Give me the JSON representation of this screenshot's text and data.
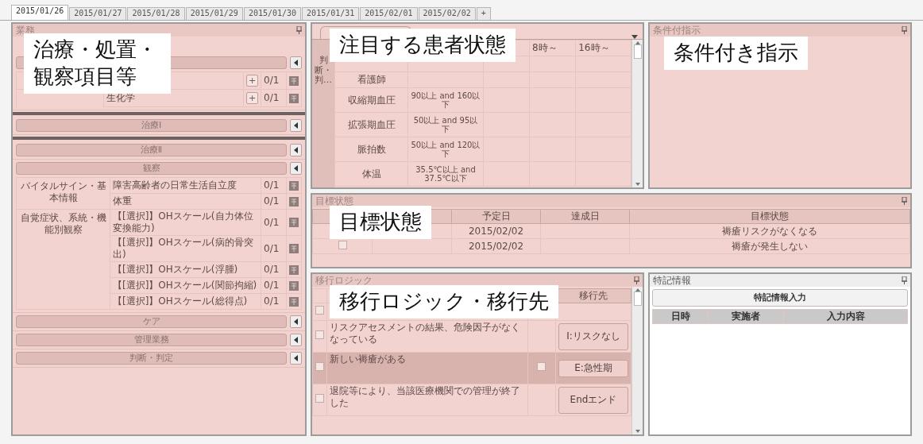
{
  "tabs": [
    {
      "label": "2015/01/26",
      "selected": true
    },
    {
      "label": "2015/01/27",
      "selected": false
    },
    {
      "label": "2015/01/28",
      "selected": false
    },
    {
      "label": "2015/01/29",
      "selected": false
    },
    {
      "label": "2015/01/30",
      "selected": false
    },
    {
      "label": "2015/01/31",
      "selected": false
    },
    {
      "label": "2015/02/01",
      "selected": false
    },
    {
      "label": "2015/02/02",
      "selected": false
    },
    {
      "label": "+",
      "selected": false
    }
  ],
  "left_panel": {
    "title": "業務",
    "callout": "治療・処置・観察項目等",
    "sections": [
      {
        "kind": "items",
        "divider_above": false,
        "items": [
          {
            "add": "+",
            "count": "0/1"
          },
          {
            "name": "生化学",
            "add": "+",
            "count": "0/1"
          }
        ]
      },
      {
        "kind": "bar",
        "label": "治療Ⅰ",
        "divider_above": true
      },
      {
        "kind": "bar",
        "label": "治療Ⅱ",
        "divider_above": true
      },
      {
        "kind": "groups",
        "label": "観察",
        "divider_above": false,
        "groups": [
          {
            "name": "バイタルサイン・基本情報",
            "items": [
              {
                "name": "障害高齢者の日常生活自立度",
                "count": "0/1"
              },
              {
                "name": "体重",
                "count": "0/1"
              }
            ]
          },
          {
            "name": "自覚症状、系統・機能別観察",
            "items": [
              {
                "name": "【[選択]】OHスケール(自力体位変換能力)",
                "count": "0/1"
              },
              {
                "name": "【[選択]】OHスケール(病的骨突出)",
                "count": "0/1"
              },
              {
                "name": "【[選択]】OHスケール(浮腫)",
                "count": "0/1"
              },
              {
                "name": "【[選択]】OHスケール(関節拘縮)",
                "count": "0/1"
              },
              {
                "name": "【[選択]】OHスケール(総得点)",
                "count": "0/1"
              }
            ]
          }
        ]
      },
      {
        "kind": "bar",
        "label": "ケア",
        "divider_above": false
      },
      {
        "kind": "bar",
        "label": "管理業務",
        "divider_above": false
      },
      {
        "kind": "bar",
        "label": "判断・判定",
        "divider_above": false
      }
    ]
  },
  "patient_state": {
    "callout": "注目する患者状態",
    "side_label": "判断・判…",
    "columns": [
      "8時～",
      "16時～"
    ],
    "rows": [
      {
        "name": "看護師"
      },
      {
        "name": "収縮期血圧",
        "criteria": "90以上 and 160以下"
      },
      {
        "name": "拡張期血圧",
        "criteria": "50以上 and 95以下"
      },
      {
        "name": "脈拍数",
        "criteria": "50以上 and 120以下"
      },
      {
        "name": "体温",
        "criteria": "35.5℃以上 and 37.5℃以下"
      }
    ]
  },
  "conditional_orders": {
    "title": "条件付指示",
    "callout": "条件付き指示"
  },
  "target_state": {
    "title": "目標状態",
    "callout": "目標状態",
    "columns": [
      "予定日",
      "達成日",
      "目標状態"
    ],
    "rows": [
      {
        "planned": "2015/02/02",
        "goal": "褥瘡リスクがなくなる"
      },
      {
        "checked": false,
        "planned": "2015/02/02",
        "goal": "褥瘡が発生しない"
      }
    ]
  },
  "transition_logic": {
    "title": "移行ロジック",
    "callout": "移行ロジック・移行先",
    "target_column": "移行先",
    "rows": [
      {
        "checked": false,
        "selected": false
      },
      {
        "checked": false,
        "selected": false,
        "condition": "リスクアセスメントの結果、危険因子がなくなっている",
        "target": "I:リスクなし"
      },
      {
        "checked": false,
        "selected": true,
        "condition": "新しい褥瘡がある",
        "flag": false,
        "target": "E:急性期"
      },
      {
        "checked": false,
        "selected": false,
        "condition": "退院等により、当該医療機関での管理が終了した",
        "target": "Endエンド"
      }
    ]
  },
  "special_info": {
    "title": "特記情報",
    "button": "特記情報入力",
    "columns": [
      "日時",
      "実施者",
      "入力内容"
    ]
  }
}
